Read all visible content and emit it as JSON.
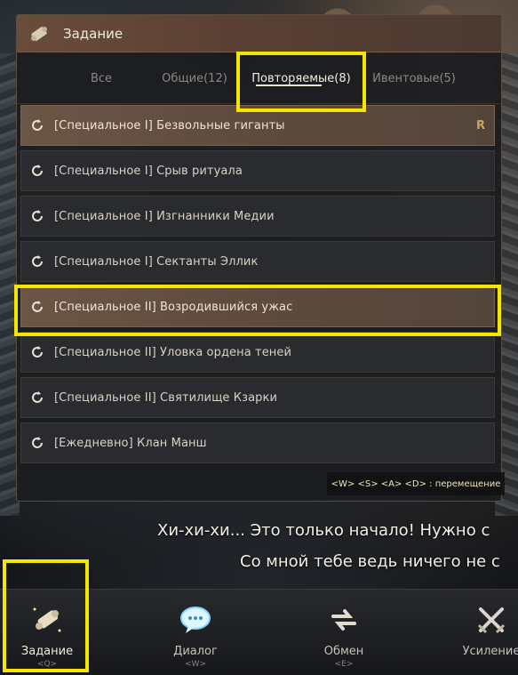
{
  "window": {
    "title": "Задание"
  },
  "tabs": [
    {
      "label": "Все",
      "active": false
    },
    {
      "label": "Общие(12)",
      "active": false
    },
    {
      "label": "Повторяемые(8)",
      "active": true
    },
    {
      "label": "Ивентовые(5)",
      "active": false
    }
  ],
  "quests": [
    {
      "label": "[Специальное I] Безвольные гиганты",
      "badge": "R",
      "selected": true
    },
    {
      "label": "[Специальное I] Срыв ритуала",
      "badge": ""
    },
    {
      "label": "[Специальное I] Изгнанники Медии",
      "badge": ""
    },
    {
      "label": "[Специальное I] Сектанты Эллик",
      "badge": ""
    },
    {
      "label": "[Специальное II] Возродившийся ужас",
      "badge": "",
      "selected": true
    },
    {
      "label": "[Специальное II] Уловка ордена теней",
      "badge": ""
    },
    {
      "label": "[Специальное II] Святилище Кзарки",
      "badge": ""
    },
    {
      "label": "[Ежедневно] Клан Манш",
      "badge": ""
    }
  ],
  "hint": "<W> <S> <A> <D> : перемещение",
  "subtitles": {
    "line1": "Хи-хи-хи... Это только начало! Нужно с",
    "line2": "Со мной тебе ведь ничего не с"
  },
  "actions": [
    {
      "label": "Задание",
      "key": "<Q>"
    },
    {
      "label": "Диалог",
      "key": "<W>"
    },
    {
      "label": "Обмен",
      "key": "<E>"
    },
    {
      "label": "Усиление",
      "key": ""
    }
  ],
  "colors": {
    "highlight": "#f5e600",
    "accent_gold": "#c9a35a",
    "header_brown": "#6a4c3a"
  },
  "icons": {
    "header": "scroll-icon",
    "quest": "repeat-icon",
    "dialog": "speech-bubble-icon",
    "trade": "exchange-arrows-icon",
    "enhance": "crossed-swords-icon"
  }
}
